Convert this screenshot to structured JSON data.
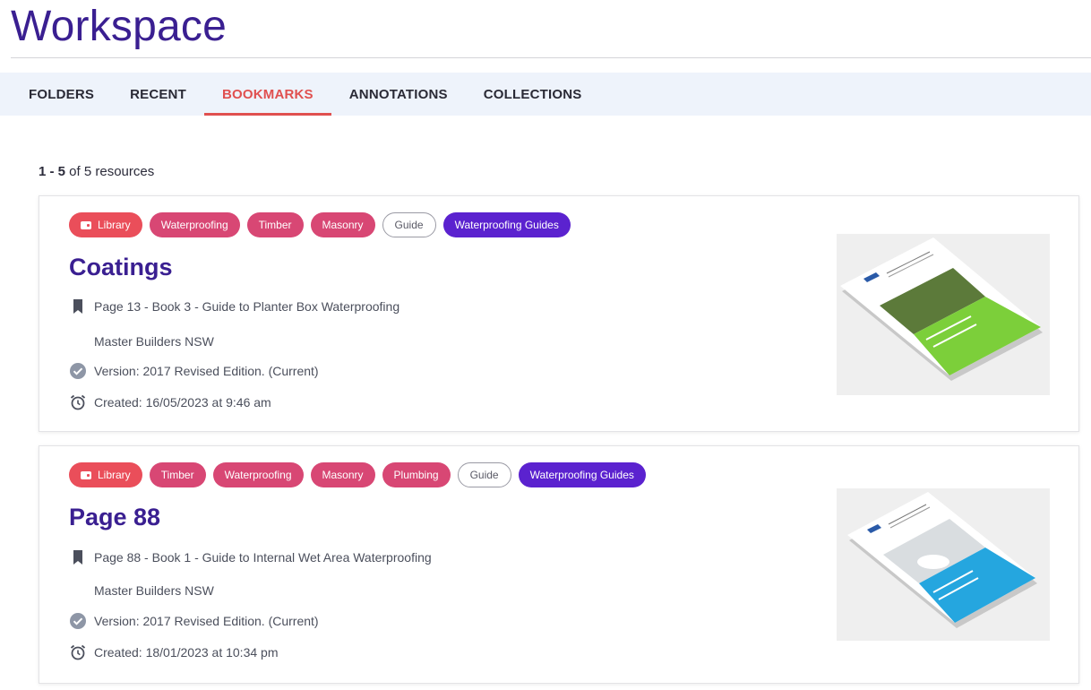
{
  "page": {
    "title": "Workspace"
  },
  "tabs": [
    {
      "label": "FOLDERS"
    },
    {
      "label": "RECENT"
    },
    {
      "label": "BOOKMARKS",
      "active": true
    },
    {
      "label": "ANNOTATIONS"
    },
    {
      "label": "COLLECTIONS"
    }
  ],
  "results": {
    "range": "1 - 5",
    "suffix": " of 5 resources"
  },
  "colors": {
    "accent": "#e0504f",
    "brand": "#3a1f91",
    "purple": "#5b22cf",
    "pink": "#d84774",
    "library": "#ea4e5a"
  },
  "cards": [
    {
      "tags": [
        "Library",
        "Waterproofing",
        "Timber",
        "Masonry",
        "Guide",
        "Waterproofing Guides"
      ],
      "title": "Coatings",
      "bookmark": "Page 13 - Book 3 - Guide to Planter Box Waterproofing",
      "publisher": "Master Builders NSW",
      "version": "Version:  2017 Revised Edition.  (Current)",
      "created": "Created: 16/05/2023 at 9:46 am",
      "cover_color": "#7ccf3a"
    },
    {
      "tags": [
        "Library",
        "Timber",
        "Waterproofing",
        "Masonry",
        "Plumbing",
        "Guide",
        "Waterproofing Guides"
      ],
      "title": "Page 88",
      "bookmark": "Page 88 - Book 1 - Guide to Internal Wet Area Waterproofing",
      "publisher": "Master Builders NSW",
      "version": "Version:  2017 Revised Edition.  (Current)",
      "created": "Created: 18/01/2023 at 10:34 pm",
      "cover_color": "#25a6df"
    }
  ]
}
